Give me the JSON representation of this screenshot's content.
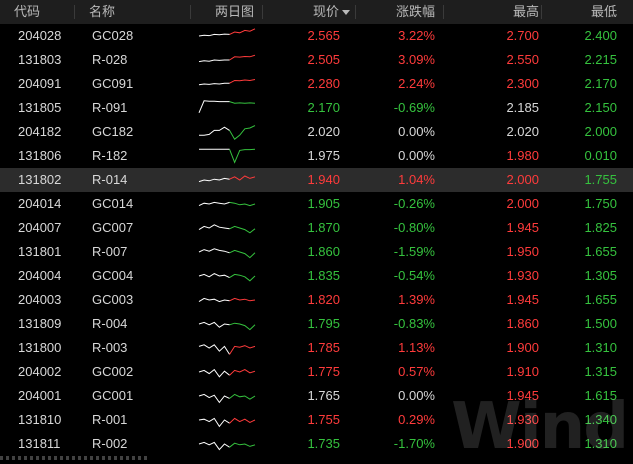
{
  "colors": {
    "up": "#ff3b3b",
    "down": "#35c23e",
    "flat": "#d8d8d8",
    "chart_base": "#ffffff"
  },
  "header": {
    "code": "代码",
    "name": "名称",
    "chart": "两日图",
    "price": "现价",
    "price_sort_icon": "sort-desc-icon",
    "change_pct": "涨跌幅",
    "high": "最高",
    "low": "最低"
  },
  "rows": [
    {
      "code": "204028",
      "name": "GC028",
      "price": "2.565",
      "change": "3.22%",
      "high": "2.700",
      "low": "2.400",
      "price_dir": "up",
      "change_dir": "up",
      "high_dir": "up",
      "low_dir": "down",
      "spark": [
        0.5,
        0.55,
        0.52,
        0.6,
        0.58,
        0.62,
        0.6,
        0.75,
        0.7,
        0.85,
        0.8,
        0.95
      ]
    },
    {
      "code": "131803",
      "name": "R-028",
      "price": "2.505",
      "change": "3.09%",
      "high": "2.550",
      "low": "2.215",
      "price_dir": "up",
      "change_dir": "up",
      "high_dir": "up",
      "low_dir": "down",
      "spark": [
        0.4,
        0.45,
        0.42,
        0.5,
        0.48,
        0.5,
        0.5,
        0.7,
        0.68,
        0.72,
        0.7,
        0.8
      ]
    },
    {
      "code": "204091",
      "name": "GC091",
      "price": "2.280",
      "change": "2.24%",
      "high": "2.300",
      "low": "2.170",
      "price_dir": "up",
      "change_dir": "up",
      "high_dir": "up",
      "low_dir": "down",
      "spark": [
        0.45,
        0.5,
        0.48,
        0.52,
        0.5,
        0.55,
        0.55,
        0.72,
        0.7,
        0.75,
        0.72,
        0.78
      ]
    },
    {
      "code": "131805",
      "name": "R-091",
      "price": "2.170",
      "change": "-0.69%",
      "high": "2.185",
      "low": "2.150",
      "price_dir": "down",
      "change_dir": "down",
      "high_dir": "flat",
      "low_dir": "down",
      "spark": [
        0.2,
        0.95,
        0.92,
        0.92,
        0.9,
        0.9,
        0.9,
        0.8,
        0.82,
        0.8,
        0.82,
        0.8
      ]
    },
    {
      "code": "204182",
      "name": "GC182",
      "price": "2.020",
      "change": "0.00%",
      "high": "2.020",
      "low": "2.000",
      "price_dir": "flat",
      "change_dir": "flat",
      "high_dir": "flat",
      "low_dir": "down",
      "spark": [
        0.3,
        0.3,
        0.35,
        0.6,
        0.6,
        0.8,
        0.6,
        0.05,
        0.3,
        0.7,
        0.75,
        0.9
      ]
    },
    {
      "code": "131806",
      "name": "R-182",
      "price": "1.975",
      "change": "0.00%",
      "high": "1.980",
      "low": "0.010",
      "price_dir": "flat",
      "change_dir": "flat",
      "high_dir": "up",
      "low_dir": "down",
      "spark": [
        0.92,
        0.92,
        0.92,
        0.92,
        0.92,
        0.92,
        0.92,
        0.1,
        0.85,
        0.9,
        0.9,
        0.92
      ]
    },
    {
      "code": "131802",
      "name": "R-014",
      "price": "1.940",
      "change": "1.04%",
      "high": "2.000",
      "low": "1.755",
      "price_dir": "up",
      "change_dir": "up",
      "high_dir": "up",
      "low_dir": "down",
      "spark": [
        0.4,
        0.5,
        0.45,
        0.55,
        0.5,
        0.6,
        0.55,
        0.7,
        0.5,
        0.75,
        0.6,
        0.7
      ]
    },
    {
      "code": "204014",
      "name": "GC014",
      "price": "1.905",
      "change": "-0.26%",
      "high": "2.000",
      "low": "1.750",
      "price_dir": "down",
      "change_dir": "down",
      "high_dir": "up",
      "low_dir": "down",
      "spark": [
        0.4,
        0.55,
        0.5,
        0.6,
        0.55,
        0.5,
        0.6,
        0.55,
        0.45,
        0.5,
        0.4,
        0.5
      ]
    },
    {
      "code": "204007",
      "name": "GC007",
      "price": "1.870",
      "change": "-0.80%",
      "high": "1.945",
      "low": "1.825",
      "price_dir": "down",
      "change_dir": "down",
      "high_dir": "up",
      "low_dir": "down",
      "spark": [
        0.4,
        0.6,
        0.5,
        0.7,
        0.55,
        0.5,
        0.45,
        0.6,
        0.5,
        0.4,
        0.2,
        0.45
      ]
    },
    {
      "code": "131801",
      "name": "R-007",
      "price": "1.860",
      "change": "-1.59%",
      "high": "1.950",
      "low": "1.655",
      "price_dir": "down",
      "change_dir": "down",
      "high_dir": "up",
      "low_dir": "down",
      "spark": [
        0.5,
        0.65,
        0.55,
        0.7,
        0.6,
        0.55,
        0.45,
        0.6,
        0.5,
        0.4,
        0.15,
        0.45
      ]
    },
    {
      "code": "204004",
      "name": "GC004",
      "price": "1.835",
      "change": "-0.54%",
      "high": "1.930",
      "low": "1.305",
      "price_dir": "down",
      "change_dir": "down",
      "high_dir": "up",
      "low_dir": "down",
      "spark": [
        0.5,
        0.6,
        0.45,
        0.65,
        0.5,
        0.55,
        0.4,
        0.6,
        0.55,
        0.45,
        0.2,
        0.5
      ]
    },
    {
      "code": "204003",
      "name": "GC003",
      "price": "1.820",
      "change": "1.39%",
      "high": "1.945",
      "low": "1.655",
      "price_dir": "up",
      "change_dir": "up",
      "high_dir": "up",
      "low_dir": "down",
      "spark": [
        0.4,
        0.6,
        0.5,
        0.55,
        0.4,
        0.5,
        0.45,
        0.6,
        0.5,
        0.55,
        0.45,
        0.5
      ]
    },
    {
      "code": "131809",
      "name": "R-004",
      "price": "1.795",
      "change": "-0.83%",
      "high": "1.860",
      "low": "1.500",
      "price_dir": "down",
      "change_dir": "down",
      "high_dir": "up",
      "low_dir": "down",
      "spark": [
        0.5,
        0.6,
        0.45,
        0.6,
        0.3,
        0.5,
        0.45,
        0.55,
        0.5,
        0.4,
        0.15,
        0.45
      ]
    },
    {
      "code": "131800",
      "name": "R-003",
      "price": "1.785",
      "change": "1.13%",
      "high": "1.900",
      "low": "1.310",
      "price_dir": "up",
      "change_dir": "up",
      "high_dir": "up",
      "low_dir": "down",
      "spark": [
        0.6,
        0.7,
        0.5,
        0.7,
        0.3,
        0.6,
        0.1,
        0.6,
        0.55,
        0.65,
        0.5,
        0.6
      ]
    },
    {
      "code": "204002",
      "name": "GC002",
      "price": "1.775",
      "change": "0.57%",
      "high": "1.910",
      "low": "1.315",
      "price_dir": "up",
      "change_dir": "up",
      "high_dir": "up",
      "low_dir": "down",
      "spark": [
        0.5,
        0.6,
        0.4,
        0.65,
        0.2,
        0.55,
        0.3,
        0.6,
        0.5,
        0.65,
        0.45,
        0.55
      ]
    },
    {
      "code": "204001",
      "name": "GC001",
      "price": "1.765",
      "change": "0.00%",
      "high": "1.945",
      "low": "1.615",
      "price_dir": "flat",
      "change_dir": "flat",
      "high_dir": "up",
      "low_dir": "down",
      "spark": [
        0.5,
        0.6,
        0.4,
        0.55,
        0.1,
        0.5,
        0.35,
        0.6,
        0.45,
        0.5,
        0.3,
        0.5
      ]
    },
    {
      "code": "131810",
      "name": "R-001",
      "price": "1.755",
      "change": "0.29%",
      "high": "1.930",
      "low": "1.340",
      "price_dir": "up",
      "change_dir": "up",
      "high_dir": "up",
      "low_dir": "down",
      "spark": [
        0.5,
        0.55,
        0.4,
        0.6,
        0.1,
        0.5,
        0.3,
        0.6,
        0.4,
        0.55,
        0.35,
        0.5
      ]
    },
    {
      "code": "131811",
      "name": "R-002",
      "price": "1.735",
      "change": "-1.70%",
      "high": "1.900",
      "low": "1.310",
      "price_dir": "down",
      "change_dir": "down",
      "high_dir": "up",
      "low_dir": "down",
      "spark": [
        0.5,
        0.6,
        0.45,
        0.6,
        0.15,
        0.5,
        0.3,
        0.55,
        0.45,
        0.5,
        0.35,
        0.45
      ]
    }
  ],
  "selected_row": 6,
  "watermark": "Wind"
}
